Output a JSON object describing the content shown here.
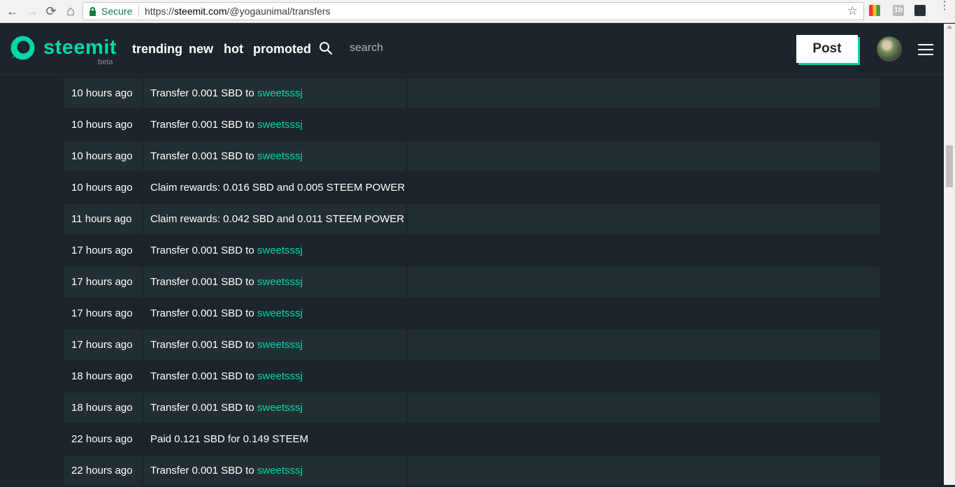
{
  "browser": {
    "back_icon": "←",
    "forward_icon": "→",
    "reload_icon": "⟳",
    "home_icon": "⌂",
    "secure_label": "Secure",
    "url_prefix": "https://",
    "url_host": "steemit.com",
    "url_path": "/@yogaunimal/transfers",
    "star_icon": "☆",
    "ext2_label": "1b",
    "menu_icon": "⋮"
  },
  "header": {
    "logo_text": "steemit",
    "logo_beta": "beta",
    "nav": [
      "trending",
      "new",
      "hot",
      "promoted"
    ],
    "search_placeholder": "search",
    "post_label": "Post",
    "accent_color": "#06d6a9",
    "background_color": "#1c252b"
  },
  "transfers": [
    {
      "time": "10 hours ago",
      "prefix": "Transfer 0.001 SBD to ",
      "user": "sweetsssj",
      "memo": ""
    },
    {
      "time": "10 hours ago",
      "prefix": "Transfer 0.001 SBD to ",
      "user": "sweetsssj",
      "memo": ""
    },
    {
      "time": "10 hours ago",
      "prefix": "Transfer 0.001 SBD to ",
      "user": "sweetsssj",
      "memo": ""
    },
    {
      "time": "10 hours ago",
      "prefix": "Claim rewards: 0.016 SBD and 0.005 STEEM POWER",
      "user": "",
      "memo": ""
    },
    {
      "time": "11 hours ago",
      "prefix": "Claim rewards: 0.042 SBD and 0.011 STEEM POWER",
      "user": "",
      "memo": ""
    },
    {
      "time": "17 hours ago",
      "prefix": "Transfer 0.001 SBD to ",
      "user": "sweetsssj",
      "memo": ""
    },
    {
      "time": "17 hours ago",
      "prefix": "Transfer 0.001 SBD to ",
      "user": "sweetsssj",
      "memo": ""
    },
    {
      "time": "17 hours ago",
      "prefix": "Transfer 0.001 SBD to ",
      "user": "sweetsssj",
      "memo": ""
    },
    {
      "time": "17 hours ago",
      "prefix": "Transfer 0.001 SBD to ",
      "user": "sweetsssj",
      "memo": ""
    },
    {
      "time": "18 hours ago",
      "prefix": "Transfer 0.001 SBD to ",
      "user": "sweetsssj",
      "memo": ""
    },
    {
      "time": "18 hours ago",
      "prefix": "Transfer 0.001 SBD to ",
      "user": "sweetsssj",
      "memo": ""
    },
    {
      "time": "22 hours ago",
      "prefix": "Paid 0.121 SBD for 0.149 STEEM",
      "user": "",
      "memo": ""
    },
    {
      "time": "22 hours ago",
      "prefix": "Transfer 0.001 SBD to ",
      "user": "sweetsssj",
      "memo": ""
    }
  ]
}
